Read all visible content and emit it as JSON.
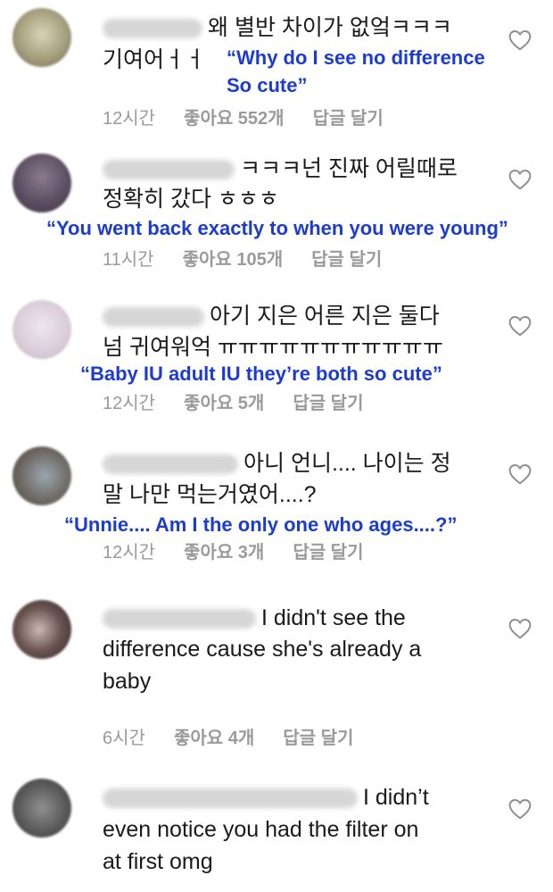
{
  "comments": [
    {
      "text_lines": [
        "왜 별반 차이가 없엌ㅋㅋㅋ",
        "기여어ㅓㅓ"
      ],
      "translation_lines": [
        "“Why do I see no difference",
        "So cute”"
      ],
      "time": "12시간",
      "likes": "좋아요 552개",
      "reply": "답글 달기"
    },
    {
      "text_lines": [
        "ㅋㅋㅋ넌 진짜 어릴때로",
        "정확히 갔다 ㅎㅎㅎ"
      ],
      "translation_lines": [
        "“You went back exactly to when you were young”"
      ],
      "time": "11시간",
      "likes": "좋아요 105개",
      "reply": "답글 달기"
    },
    {
      "text_lines": [
        "아기 지은 어른 지은 둘다",
        "넘 귀여워억 ㅠㅠㅠㅠㅠㅠㅠㅠㅠㅠㅠ"
      ],
      "translation_lines": [
        "“Baby IU adult IU they’re both so cute”"
      ],
      "time": "12시간",
      "likes": "좋아요 5개",
      "reply": "답글 달기"
    },
    {
      "text_lines": [
        "아니 언니.... 나이는 정",
        "말 나만 먹는거였어....?"
      ],
      "translation_lines": [
        "“Unnie.... Am I the only one who ages....?”"
      ],
      "time": "12시간",
      "likes": "좋아요 3개",
      "reply": "답글 달기"
    },
    {
      "text_lines": [
        "I didn't see the",
        "difference cause she's already a",
        "baby"
      ],
      "translation_lines": [],
      "time": "6시간",
      "likes": "좋아요 4개",
      "reply": "답글 달기"
    },
    {
      "text_lines": [
        "I didn’t",
        "even notice you had the filter on",
        "at first omg"
      ],
      "translation_lines": [],
      "time": "",
      "likes": "",
      "reply": ""
    }
  ],
  "colors": {
    "translation": "#1c3ccf",
    "meta": "#9a9a9a",
    "text": "#1a1a1a"
  },
  "icons": {
    "like": "heart-outline-icon"
  }
}
